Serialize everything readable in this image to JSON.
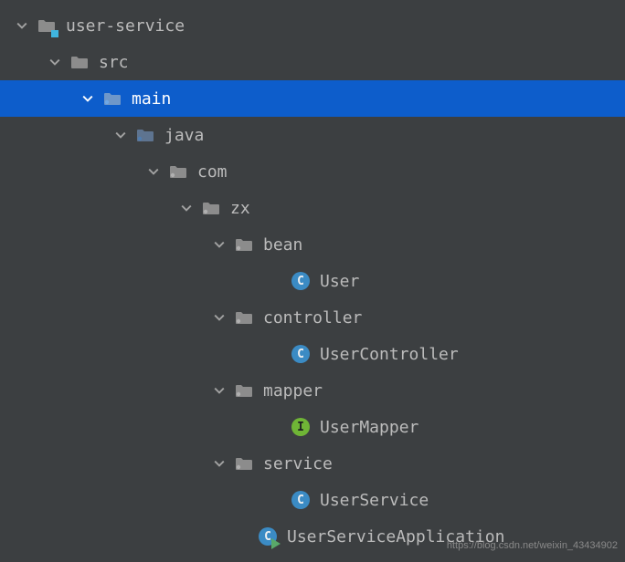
{
  "tree": {
    "nodes": [
      {
        "indent": 14,
        "expanded": true,
        "iconType": "module-folder",
        "label": "user-service",
        "selected": false,
        "name": "module-user-service"
      },
      {
        "indent": 50,
        "expanded": true,
        "iconType": "folder-gray",
        "label": "src",
        "selected": false,
        "name": "folder-src"
      },
      {
        "indent": 86,
        "expanded": true,
        "iconType": "folder-blue",
        "label": "main",
        "selected": true,
        "name": "folder-main"
      },
      {
        "indent": 122,
        "expanded": true,
        "iconType": "folder-blue",
        "label": "java",
        "selected": false,
        "name": "folder-java"
      },
      {
        "indent": 158,
        "expanded": true,
        "iconType": "package",
        "label": "com",
        "selected": false,
        "name": "package-com"
      },
      {
        "indent": 194,
        "expanded": true,
        "iconType": "package",
        "label": "zx",
        "selected": false,
        "name": "package-zx"
      },
      {
        "indent": 230,
        "expanded": true,
        "iconType": "package",
        "label": "bean",
        "selected": false,
        "name": "package-bean"
      },
      {
        "indent": 292,
        "expanded": null,
        "iconType": "class",
        "label": "User",
        "selected": false,
        "name": "class-user"
      },
      {
        "indent": 230,
        "expanded": true,
        "iconType": "package",
        "label": "controller",
        "selected": false,
        "name": "package-controller"
      },
      {
        "indent": 292,
        "expanded": null,
        "iconType": "class",
        "label": "UserController",
        "selected": false,
        "name": "class-usercontroller"
      },
      {
        "indent": 230,
        "expanded": true,
        "iconType": "package",
        "label": "mapper",
        "selected": false,
        "name": "package-mapper"
      },
      {
        "indent": 292,
        "expanded": null,
        "iconType": "interface",
        "label": "UserMapper",
        "selected": false,
        "name": "interface-usermapper"
      },
      {
        "indent": 230,
        "expanded": true,
        "iconType": "package",
        "label": "service",
        "selected": false,
        "name": "package-service"
      },
      {
        "indent": 292,
        "expanded": null,
        "iconType": "class",
        "label": "UserService",
        "selected": false,
        "name": "class-userservice"
      },
      {
        "indent": 256,
        "expanded": null,
        "iconType": "class-run",
        "label": "UserServiceApplication",
        "selected": false,
        "name": "class-userserviceapplication"
      }
    ]
  },
  "watermark": "https://blog.csdn.net/weixin_43434902"
}
